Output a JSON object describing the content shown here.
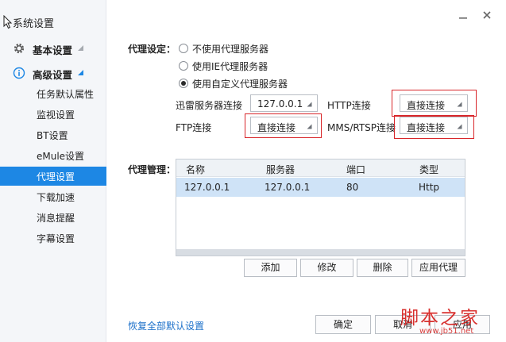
{
  "window": {
    "title": "系统设置"
  },
  "sidebar": {
    "groups": [
      {
        "label": "基本设置",
        "icon": "gear-icon"
      },
      {
        "label": "高级设置",
        "icon": "info-icon"
      }
    ],
    "items": [
      {
        "label": "任务默认属性"
      },
      {
        "label": "监视设置"
      },
      {
        "label": "BT设置"
      },
      {
        "label": "eMule设置"
      },
      {
        "label": "代理设置",
        "active": true
      },
      {
        "label": "下载加速"
      },
      {
        "label": "消息提醒"
      },
      {
        "label": "字幕设置"
      }
    ]
  },
  "proxy": {
    "section_label": "代理设定：",
    "options": [
      {
        "label": "不使用代理服务器",
        "checked": false
      },
      {
        "label": "使用IE代理服务器",
        "checked": false
      },
      {
        "label": "使用自定义代理服务器",
        "checked": true
      }
    ],
    "xunlei_label": "迅雷服务器连接",
    "xunlei_value": "127.0.0.1",
    "http_label": "HTTP连接",
    "http_value": "直接连接",
    "ftp_label": "FTP连接",
    "ftp_value": "直接连接",
    "mms_label": "MMS/RTSP连接",
    "mms_value": "直接连接"
  },
  "manage": {
    "section_label": "代理管理：",
    "columns": [
      "名称",
      "服务器",
      "端口",
      "类型"
    ],
    "rows": [
      {
        "name": "127.0.0.1",
        "server": "127.0.0.1",
        "port": "80",
        "type": "Http"
      }
    ],
    "buttons": {
      "add": "添加",
      "edit": "修改",
      "delete": "删除",
      "apply": "应用代理"
    }
  },
  "footer": {
    "restore_link": "恢复全部默认设置",
    "ok": "确定",
    "cancel": "取消",
    "apply": "应用"
  },
  "watermark": {
    "text": "脚本之家",
    "url": "www.jb51.net"
  },
  "colors": {
    "accent": "#1d87e4",
    "highlight_box": "#d8262a",
    "row_selected": "#cfe3f7",
    "link": "#1a6fc9"
  }
}
